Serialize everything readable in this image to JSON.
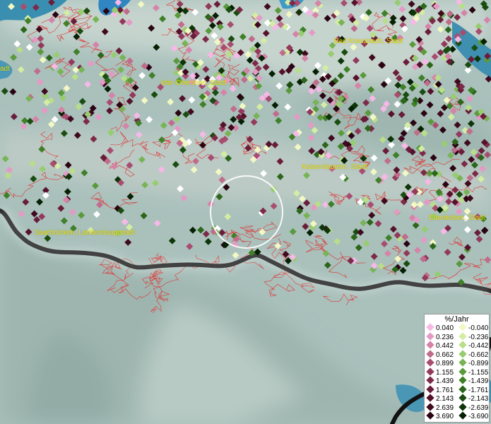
{
  "map": {
    "towns": [
      {
        "id": "bad-kreuznach",
        "label": "Bad Kreuznach, Stadt"
      },
      {
        "id": "idar-oberstein",
        "label": "Idar-Oberstein, Stadt"
      },
      {
        "id": "kaiserslautern",
        "label": "Kaiserslautern, Stadt"
      },
      {
        "id": "saarbruecken",
        "label": "Saarbrücken, Landeshauptstadt"
      },
      {
        "id": "edenkoben",
        "label": "Edenkoben, Stadt"
      },
      {
        "id": "partial-left",
        "label": "adt"
      }
    ],
    "colors": {
      "terrain": "#a9c0bb",
      "water": "#3a8fb0",
      "boundary": "#e03030",
      "border": "#111111",
      "label": "#e8e000"
    }
  },
  "legend": {
    "title": "%/Jahr",
    "positive": [
      {
        "label": "0.040",
        "color": "#f6b8e6"
      },
      {
        "label": "0.236",
        "color": "#e49ac4"
      },
      {
        "label": "0.442",
        "color": "#d683a8"
      },
      {
        "label": "0.662",
        "color": "#c06c8b"
      },
      {
        "label": "0.899",
        "color": "#a84d70"
      },
      {
        "label": "1.155",
        "color": "#93395b"
      },
      {
        "label": "1.439",
        "color": "#7d2a48"
      },
      {
        "label": "1.761",
        "color": "#6a1d39"
      },
      {
        "label": "2.143",
        "color": "#56122b"
      },
      {
        "label": "2.639",
        "color": "#400a1e"
      },
      {
        "label": "3.690",
        "color": "#2a0412"
      }
    ],
    "negative": [
      {
        "label": "-0.040",
        "color": "#f2f8c4"
      },
      {
        "label": "-0.236",
        "color": "#d4eca4"
      },
      {
        "label": "-0.442",
        "color": "#b8de8a"
      },
      {
        "label": "-0.662",
        "color": "#98cc70"
      },
      {
        "label": "-0.899",
        "color": "#78b455"
      },
      {
        "label": "-1.155",
        "color": "#5a9a3c"
      },
      {
        "label": "-1.439",
        "color": "#3f8028"
      },
      {
        "label": "-1.761",
        "color": "#2b661a"
      },
      {
        "label": "-2.143",
        "color": "#1a4d10"
      },
      {
        "label": "-2.639",
        "color": "#0d3508"
      },
      {
        "label": "-3.690",
        "color": "#062004"
      }
    ]
  }
}
